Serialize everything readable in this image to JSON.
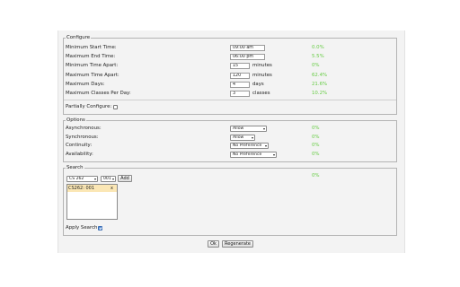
{
  "configure": {
    "legend": "Configure",
    "rows": [
      {
        "label": "Minimum Start Time:",
        "value": "09:00 am",
        "unit": "",
        "pct": "0.0%"
      },
      {
        "label": "Maximum End Time:",
        "value": "06:00 pm",
        "unit": "",
        "pct": "5.5%"
      },
      {
        "label": "Minimum Time Apart:",
        "value": "15",
        "unit": "minutes",
        "pct": "0%"
      },
      {
        "label": "Maximum Time Apart:",
        "value": "120",
        "unit": "minutes",
        "pct": "62.4%"
      },
      {
        "label": "Maximum Days:",
        "value": "4",
        "unit": "days",
        "pct": "21.6%"
      },
      {
        "label": "Maximum Classes Per Day:",
        "value": "3",
        "unit": "classes",
        "pct": "10.2%"
      }
    ],
    "partially_label": "Partially Configure:",
    "partially_checked": false
  },
  "options": {
    "legend": "Options",
    "rows": [
      {
        "label": "Asynchronous:",
        "value": "Allow",
        "pct": "0%"
      },
      {
        "label": "Synchronous:",
        "value": "Allow",
        "pct": "0%"
      },
      {
        "label": "Continuity:",
        "value": "No Preference",
        "pct": "0%"
      },
      {
        "label": "Availability:",
        "value": "No Preference",
        "pct": "0%"
      }
    ]
  },
  "search": {
    "legend": "Search",
    "course_select": "CS 262",
    "section_select": "001",
    "add_label": "Add",
    "pct": "0%",
    "list_items": [
      {
        "text": "CS262: 001",
        "remove": "x"
      }
    ],
    "apply_label": "Apply Search:",
    "apply_checked": true
  },
  "footer": {
    "ok_label": "Ok",
    "regenerate_label": "Regenerate"
  },
  "colors": {
    "pct_green": "#66cc44",
    "panel_bg": "#f3f3f3",
    "selected_item_bg": "#fbe7b5"
  }
}
